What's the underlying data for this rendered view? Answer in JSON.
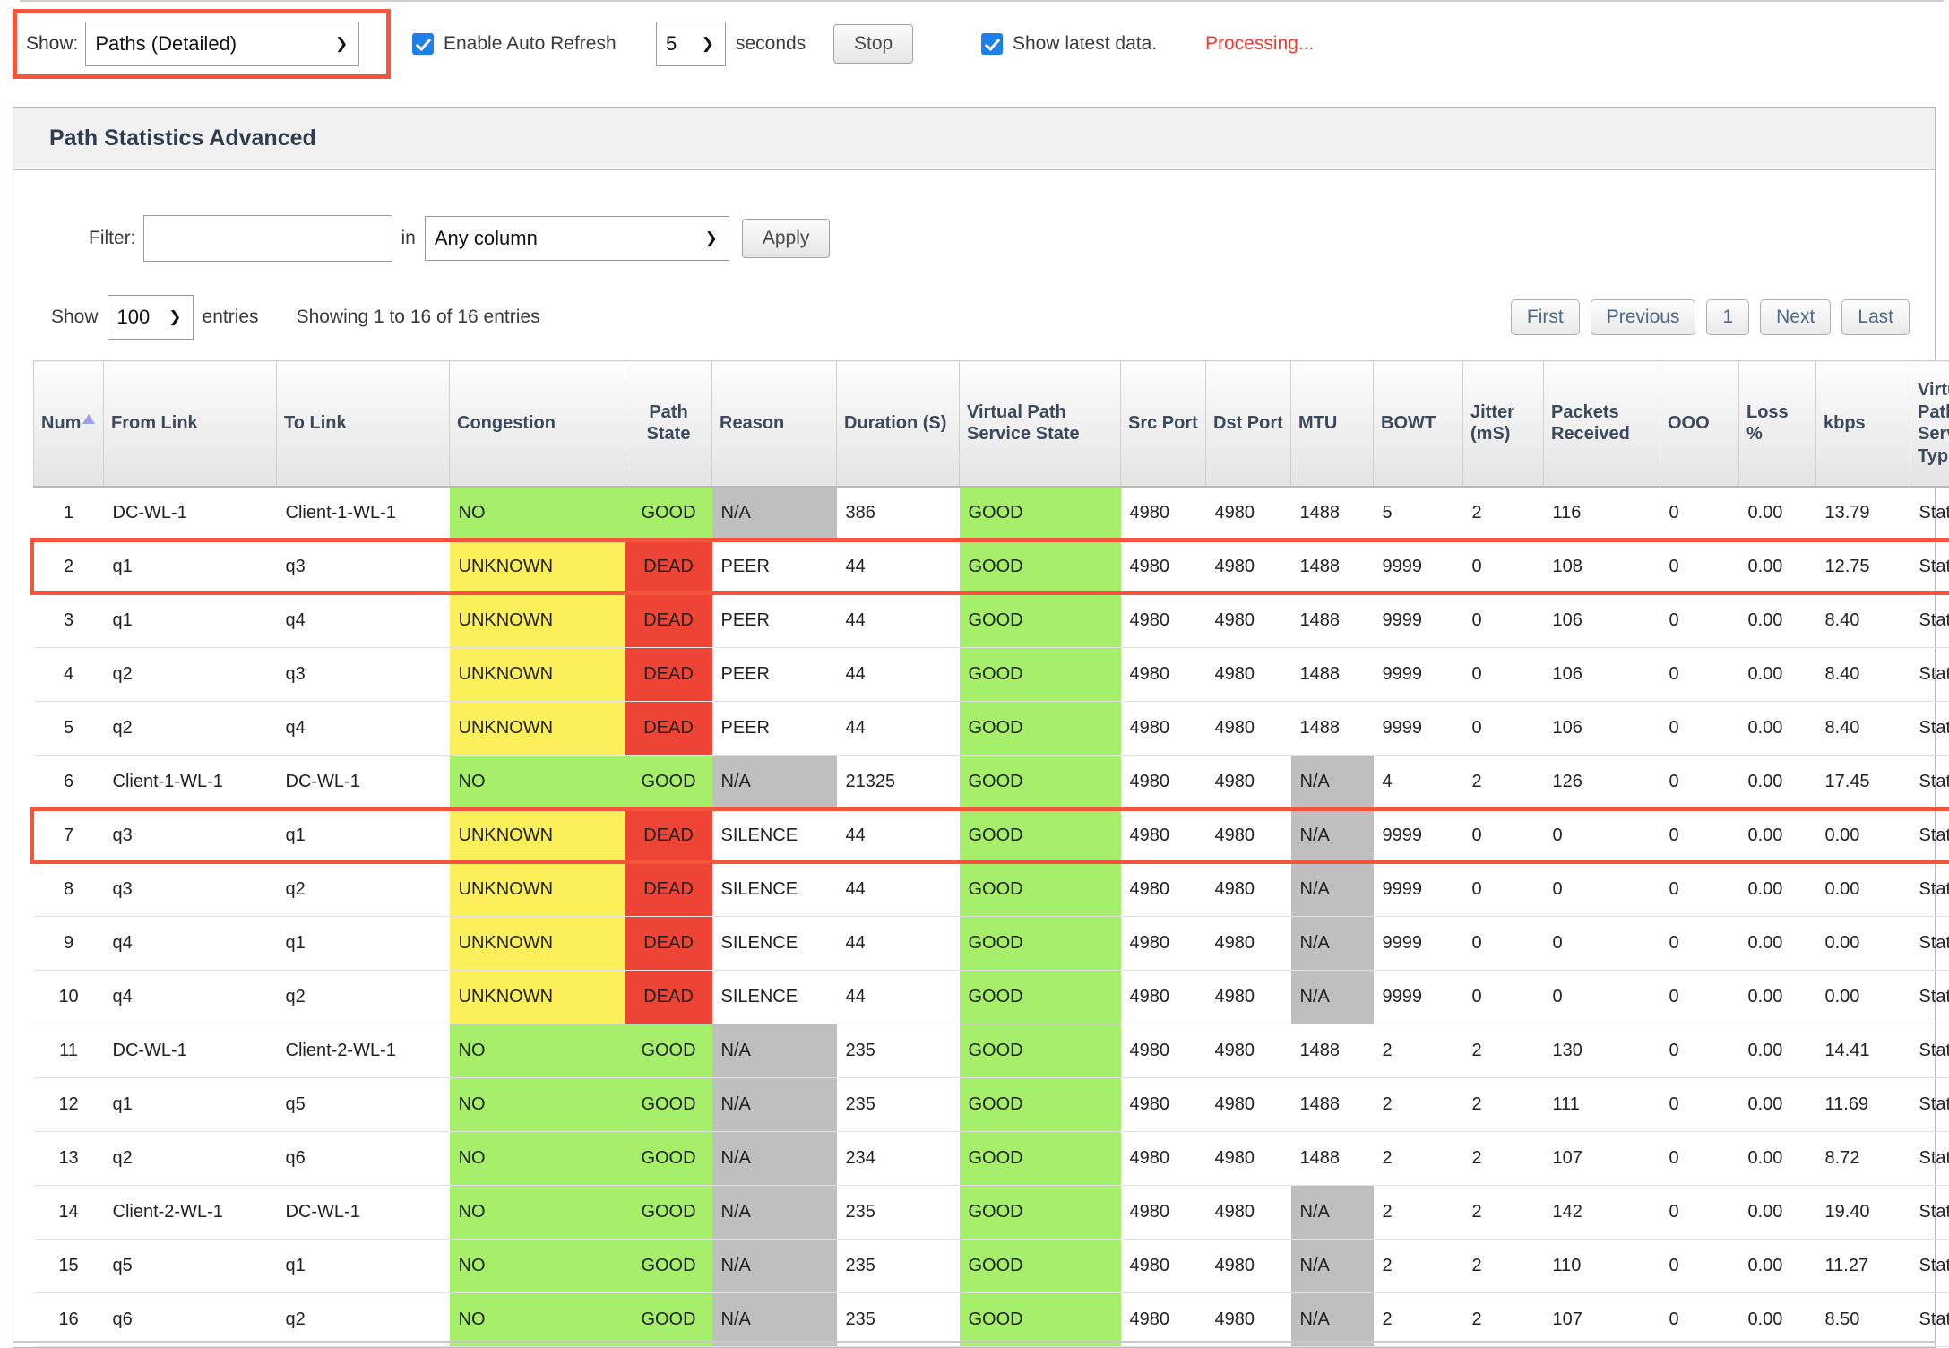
{
  "toolbar": {
    "show_label": "Show:",
    "show_value": "Paths (Detailed)",
    "auto_refresh_label": "Enable Auto Refresh",
    "auto_refresh_checked": true,
    "interval_value": "5",
    "seconds_label": "seconds",
    "stop_button": "Stop",
    "latest_data_label": "Show latest data.",
    "latest_data_checked": true,
    "status_text": "Processing...",
    "status_color": "#ef3b2d",
    "highlight_color": "#f4553c"
  },
  "panel": {
    "title": "Path Statistics Advanced",
    "filter_label": "Filter:",
    "filter_value": "",
    "filter_placeholder": "",
    "in_label": "in",
    "column_select_value": "Any column",
    "apply_button": "Apply",
    "show_label": "Show",
    "entries_value": "100",
    "entries_label": "entries",
    "showing_text": "Showing 1 to 16 of 16 entries"
  },
  "pager": {
    "first": "First",
    "previous": "Previous",
    "page": "1",
    "next": "Next",
    "last": "Last"
  },
  "table": {
    "columns": [
      "Num",
      "From Link",
      "To Link",
      "Congestion",
      "Path State",
      "Reason",
      "Duration (S)",
      "Virtual Path Service State",
      "Src Port",
      "Dst Port",
      "MTU",
      "BOWT",
      "Jitter (mS)",
      "Packets Received",
      "OOO",
      "Loss %",
      "kbps",
      "Virtual Path Service Type"
    ],
    "sorted_column": "Num",
    "sort_direction": "asc",
    "highlighted_rows": [
      2,
      7
    ],
    "rows": [
      {
        "num": "1",
        "from": "DC-WL-1",
        "to": "Client-1-WL-1",
        "congestion": "NO",
        "path_state": "GOOD",
        "reason": "N/A",
        "duration": "386",
        "vpss": "GOOD",
        "src": "4980",
        "dst": "4980",
        "mtu": "1488",
        "bowt": "5",
        "jitter": "2",
        "packets": "116",
        "ooo": "0",
        "loss": "0.00",
        "kbps": "13.79",
        "vpst": "Static"
      },
      {
        "num": "2",
        "from": "q1",
        "to": "q3",
        "congestion": "UNKNOWN",
        "path_state": "DEAD",
        "reason": "PEER",
        "duration": "44",
        "vpss": "GOOD",
        "src": "4980",
        "dst": "4980",
        "mtu": "1488",
        "bowt": "9999",
        "jitter": "0",
        "packets": "108",
        "ooo": "0",
        "loss": "0.00",
        "kbps": "12.75",
        "vpst": "Static"
      },
      {
        "num": "3",
        "from": "q1",
        "to": "q4",
        "congestion": "UNKNOWN",
        "path_state": "DEAD",
        "reason": "PEER",
        "duration": "44",
        "vpss": "GOOD",
        "src": "4980",
        "dst": "4980",
        "mtu": "1488",
        "bowt": "9999",
        "jitter": "0",
        "packets": "106",
        "ooo": "0",
        "loss": "0.00",
        "kbps": "8.40",
        "vpst": "Static"
      },
      {
        "num": "4",
        "from": "q2",
        "to": "q3",
        "congestion": "UNKNOWN",
        "path_state": "DEAD",
        "reason": "PEER",
        "duration": "44",
        "vpss": "GOOD",
        "src": "4980",
        "dst": "4980",
        "mtu": "1488",
        "bowt": "9999",
        "jitter": "0",
        "packets": "106",
        "ooo": "0",
        "loss": "0.00",
        "kbps": "8.40",
        "vpst": "Static"
      },
      {
        "num": "5",
        "from": "q2",
        "to": "q4",
        "congestion": "UNKNOWN",
        "path_state": "DEAD",
        "reason": "PEER",
        "duration": "44",
        "vpss": "GOOD",
        "src": "4980",
        "dst": "4980",
        "mtu": "1488",
        "bowt": "9999",
        "jitter": "0",
        "packets": "106",
        "ooo": "0",
        "loss": "0.00",
        "kbps": "8.40",
        "vpst": "Static"
      },
      {
        "num": "6",
        "from": "Client-1-WL-1",
        "to": "DC-WL-1",
        "congestion": "NO",
        "path_state": "GOOD",
        "reason": "N/A",
        "duration": "21325",
        "vpss": "GOOD",
        "src": "4980",
        "dst": "4980",
        "mtu": "N/A",
        "bowt": "4",
        "jitter": "2",
        "packets": "126",
        "ooo": "0",
        "loss": "0.00",
        "kbps": "17.45",
        "vpst": "Static"
      },
      {
        "num": "7",
        "from": "q3",
        "to": "q1",
        "congestion": "UNKNOWN",
        "path_state": "DEAD",
        "reason": "SILENCE",
        "duration": "44",
        "vpss": "GOOD",
        "src": "4980",
        "dst": "4980",
        "mtu": "N/A",
        "bowt": "9999",
        "jitter": "0",
        "packets": "0",
        "ooo": "0",
        "loss": "0.00",
        "kbps": "0.00",
        "vpst": "Static"
      },
      {
        "num": "8",
        "from": "q3",
        "to": "q2",
        "congestion": "UNKNOWN",
        "path_state": "DEAD",
        "reason": "SILENCE",
        "duration": "44",
        "vpss": "GOOD",
        "src": "4980",
        "dst": "4980",
        "mtu": "N/A",
        "bowt": "9999",
        "jitter": "0",
        "packets": "0",
        "ooo": "0",
        "loss": "0.00",
        "kbps": "0.00",
        "vpst": "Static"
      },
      {
        "num": "9",
        "from": "q4",
        "to": "q1",
        "congestion": "UNKNOWN",
        "path_state": "DEAD",
        "reason": "SILENCE",
        "duration": "44",
        "vpss": "GOOD",
        "src": "4980",
        "dst": "4980",
        "mtu": "N/A",
        "bowt": "9999",
        "jitter": "0",
        "packets": "0",
        "ooo": "0",
        "loss": "0.00",
        "kbps": "0.00",
        "vpst": "Static"
      },
      {
        "num": "10",
        "from": "q4",
        "to": "q2",
        "congestion": "UNKNOWN",
        "path_state": "DEAD",
        "reason": "SILENCE",
        "duration": "44",
        "vpss": "GOOD",
        "src": "4980",
        "dst": "4980",
        "mtu": "N/A",
        "bowt": "9999",
        "jitter": "0",
        "packets": "0",
        "ooo": "0",
        "loss": "0.00",
        "kbps": "0.00",
        "vpst": "Static"
      },
      {
        "num": "11",
        "from": "DC-WL-1",
        "to": "Client-2-WL-1",
        "congestion": "NO",
        "path_state": "GOOD",
        "reason": "N/A",
        "duration": "235",
        "vpss": "GOOD",
        "src": "4980",
        "dst": "4980",
        "mtu": "1488",
        "bowt": "2",
        "jitter": "2",
        "packets": "130",
        "ooo": "0",
        "loss": "0.00",
        "kbps": "14.41",
        "vpst": "Static"
      },
      {
        "num": "12",
        "from": "q1",
        "to": "q5",
        "congestion": "NO",
        "path_state": "GOOD",
        "reason": "N/A",
        "duration": "235",
        "vpss": "GOOD",
        "src": "4980",
        "dst": "4980",
        "mtu": "1488",
        "bowt": "2",
        "jitter": "2",
        "packets": "111",
        "ooo": "0",
        "loss": "0.00",
        "kbps": "11.69",
        "vpst": "Static"
      },
      {
        "num": "13",
        "from": "q2",
        "to": "q6",
        "congestion": "NO",
        "path_state": "GOOD",
        "reason": "N/A",
        "duration": "234",
        "vpss": "GOOD",
        "src": "4980",
        "dst": "4980",
        "mtu": "1488",
        "bowt": "2",
        "jitter": "2",
        "packets": "107",
        "ooo": "0",
        "loss": "0.00",
        "kbps": "8.72",
        "vpst": "Static"
      },
      {
        "num": "14",
        "from": "Client-2-WL-1",
        "to": "DC-WL-1",
        "congestion": "NO",
        "path_state": "GOOD",
        "reason": "N/A",
        "duration": "235",
        "vpss": "GOOD",
        "src": "4980",
        "dst": "4980",
        "mtu": "N/A",
        "bowt": "2",
        "jitter": "2",
        "packets": "142",
        "ooo": "0",
        "loss": "0.00",
        "kbps": "19.40",
        "vpst": "Static"
      },
      {
        "num": "15",
        "from": "q5",
        "to": "q1",
        "congestion": "NO",
        "path_state": "GOOD",
        "reason": "N/A",
        "duration": "235",
        "vpss": "GOOD",
        "src": "4980",
        "dst": "4980",
        "mtu": "N/A",
        "bowt": "2",
        "jitter": "2",
        "packets": "110",
        "ooo": "0",
        "loss": "0.00",
        "kbps": "11.27",
        "vpst": "Static"
      },
      {
        "num": "16",
        "from": "q6",
        "to": "q2",
        "congestion": "NO",
        "path_state": "GOOD",
        "reason": "N/A",
        "duration": "235",
        "vpss": "GOOD",
        "src": "4980",
        "dst": "4980",
        "mtu": "N/A",
        "bowt": "2",
        "jitter": "2",
        "packets": "107",
        "ooo": "0",
        "loss": "0.00",
        "kbps": "8.50",
        "vpst": "Static"
      }
    ]
  },
  "colors": {
    "good_green": "#a6ef6a",
    "unknown_yellow": "#fbef5a",
    "dead_red": "#ee4435",
    "na_grey": "#bfbfbf",
    "highlight_red": "#f4553c"
  }
}
